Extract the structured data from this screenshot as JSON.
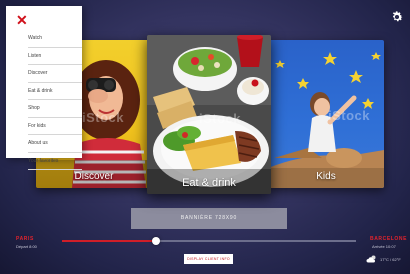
{
  "menu": {
    "close_icon": "close-icon",
    "items": [
      "Watch",
      "Listen",
      "Discover",
      "Eat & drink",
      "Shop",
      "For kids",
      "About us",
      "Your favorites"
    ]
  },
  "cards": {
    "discover": "Discover",
    "eat": "Eat & drink",
    "kids": "Kids"
  },
  "watermarks": {
    "discover": "iStock",
    "eat": "iStock",
    "kids": "iStock"
  },
  "banner": "BANNIÈRE 728X90",
  "flight": {
    "origin": "PARIS",
    "origin_time": "Départ 8:00",
    "destination": "BARCELONE",
    "destination_time": "Arrivée 10:07",
    "progress": 0.32
  },
  "ad_button": "DISPLAY CLIENT INFO",
  "weather": "17°C / 62°F",
  "colors": {
    "accent_red": "#d01e28",
    "background": "#2e3058"
  },
  "icons": {
    "settings": "gear-icon",
    "weather": "cloud-sun-icon"
  }
}
